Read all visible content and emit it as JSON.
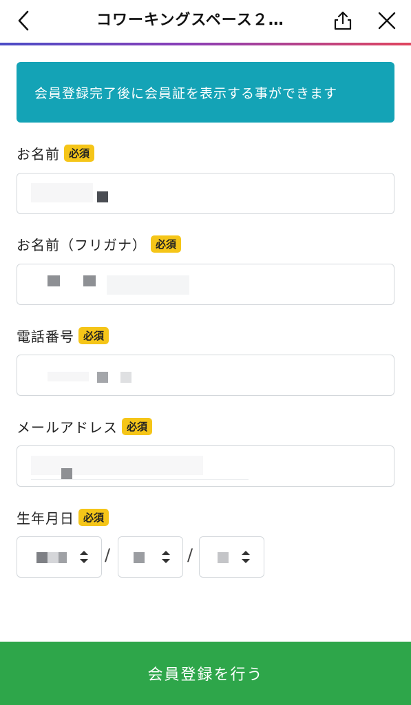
{
  "header": {
    "title": "コワーキングスペース２…",
    "icons": {
      "back": "chevron-left-icon",
      "share": "share-icon",
      "close": "close-icon"
    }
  },
  "notice": {
    "text": "会員登録完了後に会員証を表示する事ができます"
  },
  "form": {
    "required_label": "必須",
    "fields": [
      {
        "label": "お名前"
      },
      {
        "label": "お名前（フリガナ）"
      },
      {
        "label": "電話番号"
      },
      {
        "label": "メールアドレス"
      },
      {
        "label": "生年月日"
      }
    ],
    "birthday_separator": "/"
  },
  "submit": {
    "label": "会員登録を行う"
  },
  "colors": {
    "notice_bg": "#14a3b6",
    "badge_bg": "#f5c518",
    "submit_bg": "#2ea64a",
    "gradient_start": "#4b4cc6",
    "gradient_end": "#e0455e"
  }
}
